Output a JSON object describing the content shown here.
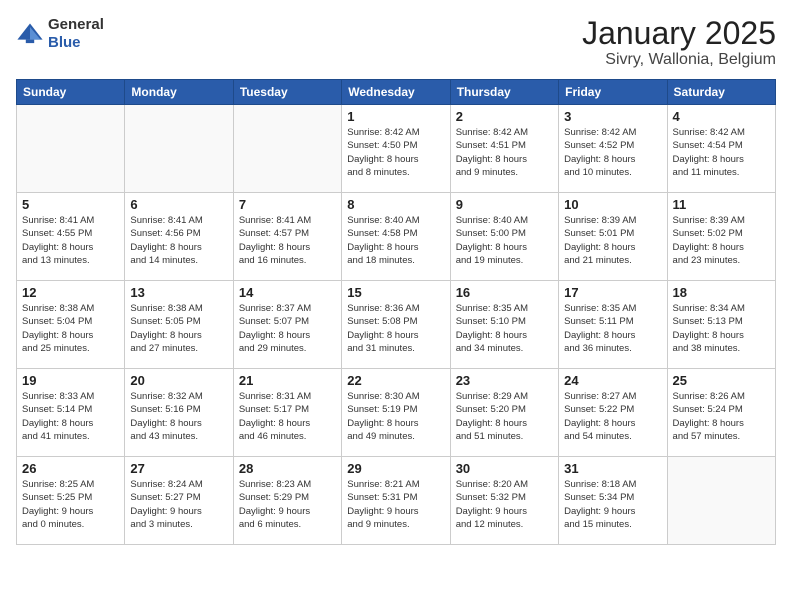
{
  "header": {
    "logo_general": "General",
    "logo_blue": "Blue",
    "title": "January 2025",
    "subtitle": "Sivry, Wallonia, Belgium"
  },
  "weekdays": [
    "Sunday",
    "Monday",
    "Tuesday",
    "Wednesday",
    "Thursday",
    "Friday",
    "Saturday"
  ],
  "weeks": [
    [
      {
        "day": "",
        "info": ""
      },
      {
        "day": "",
        "info": ""
      },
      {
        "day": "",
        "info": ""
      },
      {
        "day": "1",
        "info": "Sunrise: 8:42 AM\nSunset: 4:50 PM\nDaylight: 8 hours\nand 8 minutes."
      },
      {
        "day": "2",
        "info": "Sunrise: 8:42 AM\nSunset: 4:51 PM\nDaylight: 8 hours\nand 9 minutes."
      },
      {
        "day": "3",
        "info": "Sunrise: 8:42 AM\nSunset: 4:52 PM\nDaylight: 8 hours\nand 10 minutes."
      },
      {
        "day": "4",
        "info": "Sunrise: 8:42 AM\nSunset: 4:54 PM\nDaylight: 8 hours\nand 11 minutes."
      }
    ],
    [
      {
        "day": "5",
        "info": "Sunrise: 8:41 AM\nSunset: 4:55 PM\nDaylight: 8 hours\nand 13 minutes."
      },
      {
        "day": "6",
        "info": "Sunrise: 8:41 AM\nSunset: 4:56 PM\nDaylight: 8 hours\nand 14 minutes."
      },
      {
        "day": "7",
        "info": "Sunrise: 8:41 AM\nSunset: 4:57 PM\nDaylight: 8 hours\nand 16 minutes."
      },
      {
        "day": "8",
        "info": "Sunrise: 8:40 AM\nSunset: 4:58 PM\nDaylight: 8 hours\nand 18 minutes."
      },
      {
        "day": "9",
        "info": "Sunrise: 8:40 AM\nSunset: 5:00 PM\nDaylight: 8 hours\nand 19 minutes."
      },
      {
        "day": "10",
        "info": "Sunrise: 8:39 AM\nSunset: 5:01 PM\nDaylight: 8 hours\nand 21 minutes."
      },
      {
        "day": "11",
        "info": "Sunrise: 8:39 AM\nSunset: 5:02 PM\nDaylight: 8 hours\nand 23 minutes."
      }
    ],
    [
      {
        "day": "12",
        "info": "Sunrise: 8:38 AM\nSunset: 5:04 PM\nDaylight: 8 hours\nand 25 minutes."
      },
      {
        "day": "13",
        "info": "Sunrise: 8:38 AM\nSunset: 5:05 PM\nDaylight: 8 hours\nand 27 minutes."
      },
      {
        "day": "14",
        "info": "Sunrise: 8:37 AM\nSunset: 5:07 PM\nDaylight: 8 hours\nand 29 minutes."
      },
      {
        "day": "15",
        "info": "Sunrise: 8:36 AM\nSunset: 5:08 PM\nDaylight: 8 hours\nand 31 minutes."
      },
      {
        "day": "16",
        "info": "Sunrise: 8:35 AM\nSunset: 5:10 PM\nDaylight: 8 hours\nand 34 minutes."
      },
      {
        "day": "17",
        "info": "Sunrise: 8:35 AM\nSunset: 5:11 PM\nDaylight: 8 hours\nand 36 minutes."
      },
      {
        "day": "18",
        "info": "Sunrise: 8:34 AM\nSunset: 5:13 PM\nDaylight: 8 hours\nand 38 minutes."
      }
    ],
    [
      {
        "day": "19",
        "info": "Sunrise: 8:33 AM\nSunset: 5:14 PM\nDaylight: 8 hours\nand 41 minutes."
      },
      {
        "day": "20",
        "info": "Sunrise: 8:32 AM\nSunset: 5:16 PM\nDaylight: 8 hours\nand 43 minutes."
      },
      {
        "day": "21",
        "info": "Sunrise: 8:31 AM\nSunset: 5:17 PM\nDaylight: 8 hours\nand 46 minutes."
      },
      {
        "day": "22",
        "info": "Sunrise: 8:30 AM\nSunset: 5:19 PM\nDaylight: 8 hours\nand 49 minutes."
      },
      {
        "day": "23",
        "info": "Sunrise: 8:29 AM\nSunset: 5:20 PM\nDaylight: 8 hours\nand 51 minutes."
      },
      {
        "day": "24",
        "info": "Sunrise: 8:27 AM\nSunset: 5:22 PM\nDaylight: 8 hours\nand 54 minutes."
      },
      {
        "day": "25",
        "info": "Sunrise: 8:26 AM\nSunset: 5:24 PM\nDaylight: 8 hours\nand 57 minutes."
      }
    ],
    [
      {
        "day": "26",
        "info": "Sunrise: 8:25 AM\nSunset: 5:25 PM\nDaylight: 9 hours\nand 0 minutes."
      },
      {
        "day": "27",
        "info": "Sunrise: 8:24 AM\nSunset: 5:27 PM\nDaylight: 9 hours\nand 3 minutes."
      },
      {
        "day": "28",
        "info": "Sunrise: 8:23 AM\nSunset: 5:29 PM\nDaylight: 9 hours\nand 6 minutes."
      },
      {
        "day": "29",
        "info": "Sunrise: 8:21 AM\nSunset: 5:31 PM\nDaylight: 9 hours\nand 9 minutes."
      },
      {
        "day": "30",
        "info": "Sunrise: 8:20 AM\nSunset: 5:32 PM\nDaylight: 9 hours\nand 12 minutes."
      },
      {
        "day": "31",
        "info": "Sunrise: 8:18 AM\nSunset: 5:34 PM\nDaylight: 9 hours\nand 15 minutes."
      },
      {
        "day": "",
        "info": ""
      }
    ]
  ]
}
